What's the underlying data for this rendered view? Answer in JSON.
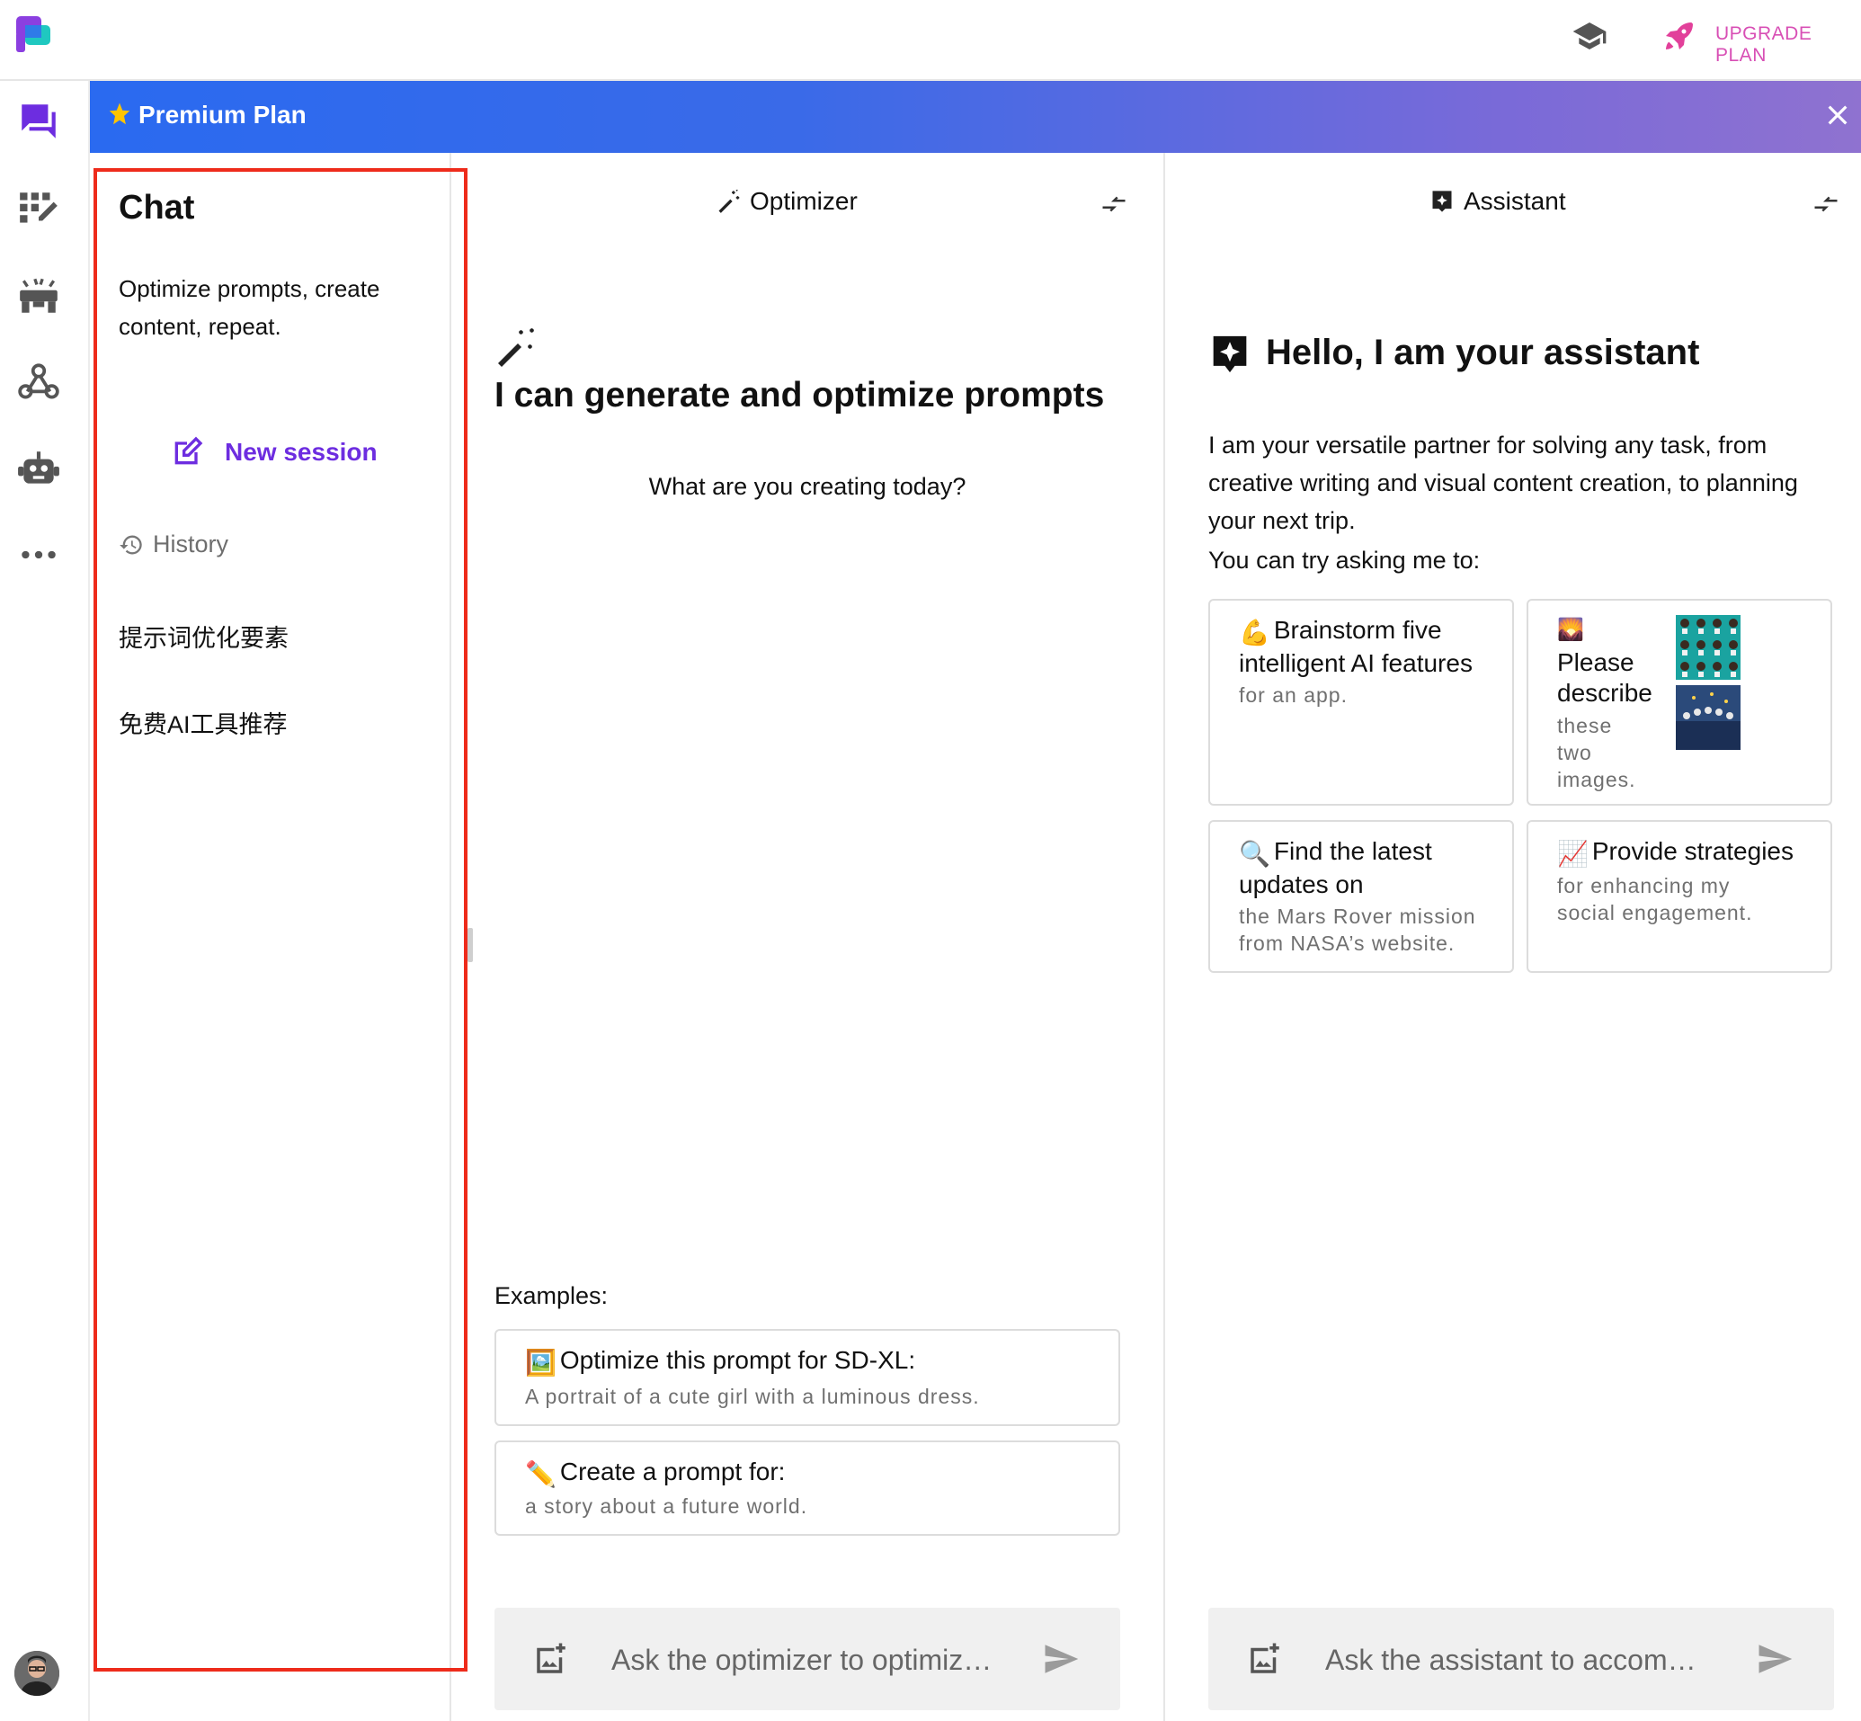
{
  "topbar": {
    "upgrade_label": "UPGRADE PLAN",
    "colors": {
      "upgrade": "#d84fb5",
      "accent": "#6d2de0"
    }
  },
  "rail": {
    "icons": [
      "chat-icon",
      "prompt-grid-icon",
      "media-icon",
      "webhook-icon",
      "robot-icon",
      "more-icon"
    ]
  },
  "banner": {
    "title": "Premium Plan",
    "gradient": [
      "#2a6af0",
      "#8f72d0"
    ]
  },
  "chat": {
    "title": "Chat",
    "subtitle": "Optimize prompts, create content, repeat.",
    "new_session_label": "New session",
    "history_label": "History",
    "history_items": [
      "提示词优化要素",
      "免费AI工具推荐"
    ]
  },
  "optimizer": {
    "header": "Optimizer",
    "headline": "I can generate and optimize prompts",
    "question": "What are you creating today?",
    "examples_label": "Examples:",
    "examples": [
      {
        "emoji": "🖼️",
        "title": "Optimize this prompt for SD-XL:",
        "subtitle": "A portrait of a cute girl with a luminous dress."
      },
      {
        "emoji": "✏️",
        "title": "Create a prompt for:",
        "subtitle": "a story about a future world."
      }
    ],
    "input_placeholder": "Ask the optimizer to optimiz…"
  },
  "assistant": {
    "header": "Assistant",
    "headline": "Hello, I am your assistant",
    "intro": "I am your versatile partner for solving any task, from creative writing and visual content creation, to planning your next trip.",
    "try_label": "You can try asking me to:",
    "cards": [
      {
        "emoji": "💪",
        "title": "Brainstorm five intelligent AI features",
        "subtitle": "for an app."
      },
      {
        "emoji": "🌄",
        "title": "Please describe",
        "subtitle": "these two images."
      },
      {
        "emoji": "🔍",
        "title": "Find the latest updates on",
        "subtitle": "the Mars Rover mission from NASA’s website."
      },
      {
        "emoji": "📈",
        "title": "Provide strategies",
        "subtitle": "for enhancing my social engagement."
      }
    ],
    "input_placeholder": "Ask the assistant to accom…"
  }
}
